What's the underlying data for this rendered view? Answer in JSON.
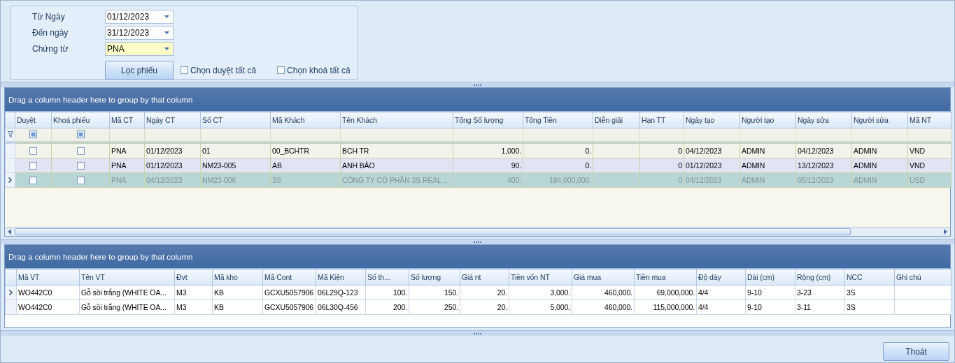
{
  "filter_panel": {
    "fields": [
      {
        "label": "Từ Ngày",
        "value": "01/12/2023",
        "focused": false
      },
      {
        "label": "Đến ngày",
        "value": "31/12/2023",
        "focused": false
      },
      {
        "label": "Chứng từ",
        "value": "PNA",
        "focused": true
      }
    ],
    "filter_button": "Lọc phiếu",
    "checkboxes": [
      {
        "label": "Chọn duyệt tất cả",
        "checked": false
      },
      {
        "label": "Chọn khoá tất cả",
        "checked": false
      }
    ]
  },
  "master_grid": {
    "group_hint": "Drag a column header here to group by that column",
    "columns": [
      {
        "label": "Duyệt",
        "kind": "check"
      },
      {
        "label": "Khoá phiếu",
        "kind": "check"
      },
      {
        "label": "Mã CT",
        "kind": "text"
      },
      {
        "label": "Ngày CT",
        "kind": "text"
      },
      {
        "label": "Số CT",
        "kind": "text"
      },
      {
        "label": "Mã Khách",
        "kind": "text"
      },
      {
        "label": "Tên Khách",
        "kind": "text"
      },
      {
        "label": "Tổng Số lượng",
        "kind": "number"
      },
      {
        "label": "Tổng Tiền",
        "kind": "number"
      },
      {
        "label": "Diễn giải",
        "kind": "text"
      },
      {
        "label": "Hạn TT",
        "kind": "number"
      },
      {
        "label": "Ngày tạo",
        "kind": "text"
      },
      {
        "label": "Người tạo",
        "kind": "text"
      },
      {
        "label": "Ngày sửa",
        "kind": "text"
      },
      {
        "label": "Người sửa",
        "kind": "text"
      },
      {
        "label": "Mã NT",
        "kind": "text"
      }
    ],
    "rows": [
      {
        "selected": false,
        "cells": [
          false,
          false,
          "PNA",
          "01/12/2023",
          "01",
          "00_BCHTR",
          "BCH TR",
          "1,000.",
          "0.",
          "",
          "0",
          "04/12/2023",
          "ADMIN",
          "04/12/2023",
          "ADMIN",
          "VND"
        ]
      },
      {
        "selected": false,
        "cells": [
          false,
          false,
          "PNA",
          "01/12/2023",
          "NM23-005",
          "AB",
          "ANH BẢO",
          "90.",
          "0.",
          "",
          "0",
          "01/12/2023",
          "ADMIN",
          "13/12/2023",
          "ADMIN",
          "VND"
        ]
      },
      {
        "selected": true,
        "cells": [
          false,
          false,
          "PNA",
          "04/12/2023",
          "NM23-006",
          "3S",
          "CÔNG TY CỔ PHẦN 3S REAL ...",
          "400.",
          "184,000,000.",
          "",
          "0",
          "04/12/2023",
          "ADMIN",
          "05/12/2023",
          "ADMIN",
          "USD"
        ]
      }
    ]
  },
  "detail_grid": {
    "group_hint": "Drag a column header here to group by that column",
    "columns": [
      {
        "label": "Mã VT",
        "kind": "text"
      },
      {
        "label": "Tên VT",
        "kind": "text"
      },
      {
        "label": "Đvt",
        "kind": "text"
      },
      {
        "label": "Mã kho",
        "kind": "text"
      },
      {
        "label": "Mã Cont",
        "kind": "text"
      },
      {
        "label": "Mã Kiện",
        "kind": "text"
      },
      {
        "label": "Số th...",
        "kind": "number"
      },
      {
        "label": "Số lượng",
        "kind": "number"
      },
      {
        "label": "Giá nt",
        "kind": "number"
      },
      {
        "label": "Tiền vốn NT",
        "kind": "number"
      },
      {
        "label": "Giá mua",
        "kind": "number"
      },
      {
        "label": "Tiền mua",
        "kind": "number"
      },
      {
        "label": "Độ dày",
        "kind": "text"
      },
      {
        "label": "Dài (cm)",
        "kind": "text"
      },
      {
        "label": "Rộng (cm)",
        "kind": "text"
      },
      {
        "label": "NCC",
        "kind": "text"
      },
      {
        "label": "Ghi chú",
        "kind": "text"
      }
    ],
    "rows": [
      {
        "selected": true,
        "cells": [
          "WO442C0",
          "Gỗ sồi trắng (WHITE OA...",
          "M3",
          "KB",
          "GCXU5057906",
          "06L29Q-123",
          "100.",
          "150.",
          "20.",
          "3,000.",
          "460,000.",
          "69,000,000.",
          "4/4",
          "9-10",
          "3-23",
          "3S",
          ""
        ]
      },
      {
        "selected": false,
        "cells": [
          "WO442C0",
          "Gỗ sồi trắng (WHITE OA...",
          "M3",
          "KB",
          "GCXU5057906",
          "06L30Q-456",
          "200.",
          "250.",
          "20.",
          "5,000.",
          "460,000.",
          "115,000,000.",
          "4/4",
          "9-10",
          "3-11",
          "3S",
          ""
        ]
      }
    ]
  },
  "exit_button": "Thoát"
}
